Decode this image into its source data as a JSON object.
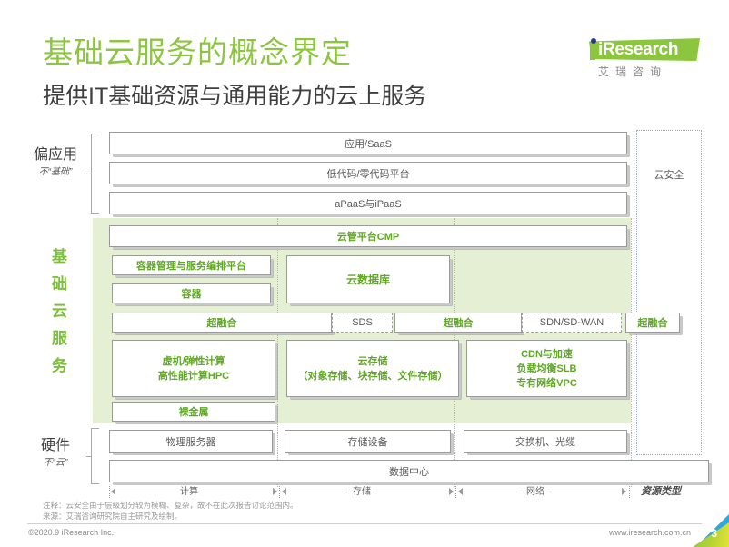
{
  "header": {
    "title": "基础云服务的概念界定",
    "subtitle": "提供IT基础资源与通用能力的云上服务",
    "title_color": "#8CC63E"
  },
  "logo": {
    "brand": "iResearch",
    "brand_cn": "艾瑞咨询",
    "color": "#8CC63E"
  },
  "side_labels": {
    "top": {
      "big": "偏应用",
      "small": "不“基础”"
    },
    "middle": {
      "chars": [
        "基",
        "础",
        "云",
        "服",
        "务"
      ]
    },
    "bottom": {
      "big": "硬件",
      "small": "不“云”"
    }
  },
  "layers": {
    "app_rows": [
      {
        "label": "应用/SaaS"
      },
      {
        "label": "低代码/零代码平台"
      },
      {
        "label": "aPaaS与iPaaS"
      }
    ],
    "cmp": {
      "label": "云管平台CMP"
    },
    "container_platform": {
      "label": "容器管理与服务编排平台"
    },
    "container": {
      "label": "容器"
    },
    "cloud_database": {
      "label": "云数据库"
    },
    "converged_row": [
      {
        "label": "超融合",
        "style": "green"
      },
      {
        "label": "SDS",
        "style": "dashed"
      },
      {
        "label": "超融合",
        "style": "green"
      },
      {
        "label": "SDN/SD-WAN",
        "style": "dashed"
      },
      {
        "label": "超融合",
        "style": "green"
      }
    ],
    "resource_boxes": [
      {
        "lines": [
          "虚机/弹性计算",
          "高性能计算HPC"
        ]
      },
      {
        "lines": [
          "云存储",
          "（对象存储、块存储、文件存储）"
        ]
      },
      {
        "lines": [
          "CDN与加速",
          "负载均衡SLB",
          "专有网络VPC"
        ]
      }
    ],
    "bare_metal": {
      "label": "裸金属"
    },
    "hardware_row": [
      {
        "label": "物理服务器"
      },
      {
        "label": "存储设备"
      },
      {
        "label": "交换机、光缆"
      }
    ],
    "datacenter": {
      "label": "数据中心"
    },
    "cloud_security": {
      "label": "云安全"
    }
  },
  "axis": {
    "segments": [
      "计算",
      "存储",
      "网络"
    ],
    "resource_type": "资源类型"
  },
  "notes": {
    "note": "注释：云安全由于层级划分较为模糊、复杂，故不在此次报告讨论范围内。",
    "source": "来源：艾瑞咨询研究院自主研究及绘制。"
  },
  "footer": {
    "copyright": "©2020.9 iResearch Inc.",
    "website": "www.iresearch.com.cn",
    "page_number": "3"
  }
}
